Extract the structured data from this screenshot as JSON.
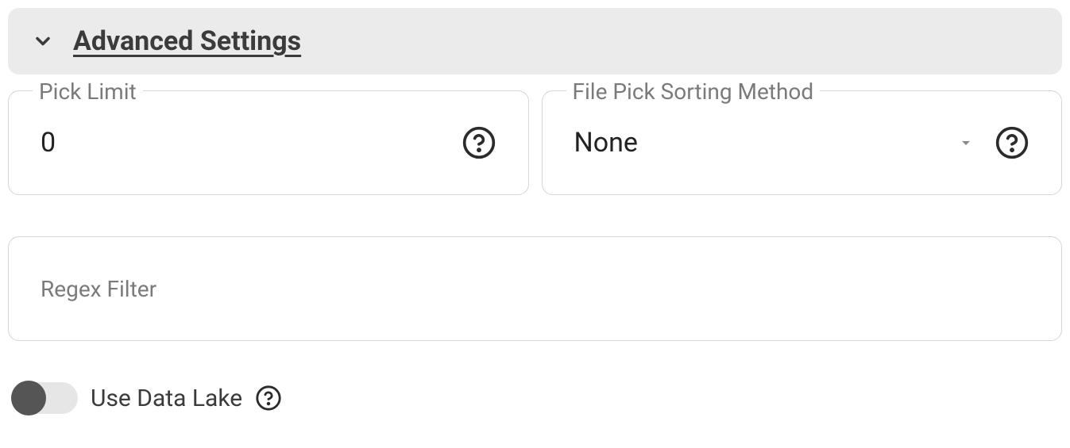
{
  "section": {
    "title": "Advanced Settings"
  },
  "fields": {
    "pick_limit": {
      "label": "Pick Limit",
      "value": "0"
    },
    "file_pick_sorting": {
      "label": "File Pick Sorting Method",
      "value": "None"
    },
    "regex_filter": {
      "label": "Regex Filter",
      "value": ""
    }
  },
  "toggle": {
    "use_data_lake_label": "Use Data Lake",
    "use_data_lake_on": false
  }
}
